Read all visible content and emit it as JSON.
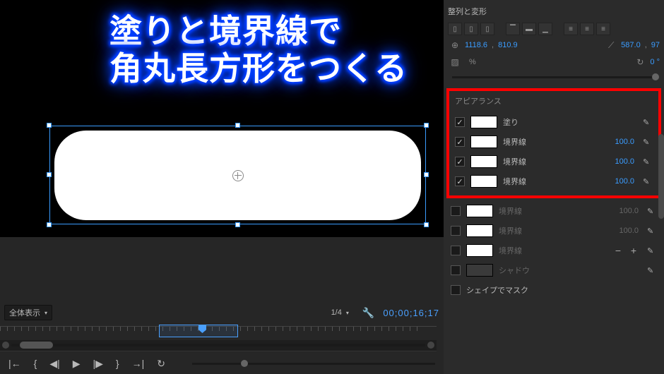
{
  "overlay": {
    "line1": "塗りと境界線で",
    "line2": "角丸長方形をつくる"
  },
  "timeline": {
    "zoom_display": "全体表示",
    "resolution": "1/4",
    "timecode": "00;00;16;17"
  },
  "panel": {
    "align_title": "整列と変形",
    "position_x": "1118.6",
    "position_y": "810.9",
    "scale_x": "587.0",
    "scale_y": "97",
    "opacity_pct": "%",
    "rotation": "0 °",
    "appearance_title": "アピアランス",
    "rows": [
      {
        "checked": true,
        "swatch": "white",
        "label": "塗り",
        "value": ""
      },
      {
        "checked": true,
        "swatch": "white",
        "label": "境界線",
        "value": "100.0"
      },
      {
        "checked": true,
        "swatch": "white",
        "label": "境界線",
        "value": "100.0"
      },
      {
        "checked": true,
        "swatch": "white",
        "label": "境界線",
        "value": "100.0"
      }
    ],
    "extra_rows": [
      {
        "checked": false,
        "swatch": "white",
        "label": "境界線",
        "value": "100.0",
        "dim": true
      },
      {
        "checked": false,
        "swatch": "white",
        "label": "境界線",
        "value": "100.0",
        "dim": true
      },
      {
        "checked": false,
        "swatch": "white",
        "label": "境界線",
        "value": "",
        "dim": true,
        "plusminus": true
      },
      {
        "checked": false,
        "swatch": "dark",
        "label": "シャドウ",
        "value": "",
        "dim": true
      }
    ],
    "mask_label": "シェイプでマスク"
  }
}
